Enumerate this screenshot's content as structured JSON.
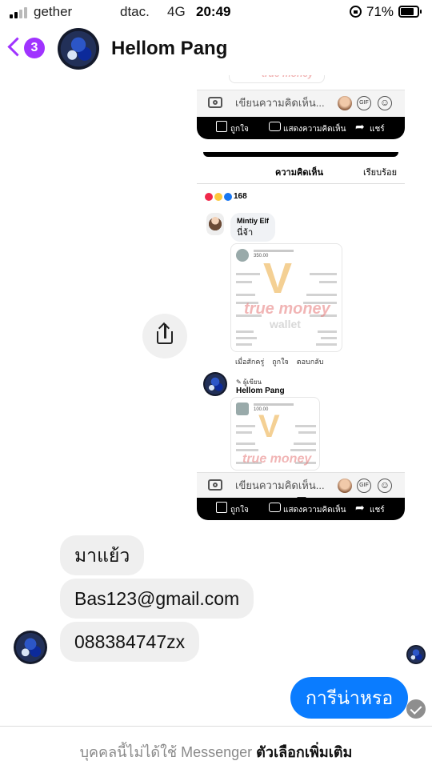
{
  "status_bar": {
    "carrier_primary": "gether",
    "carrier_secondary": "dtac.",
    "network": "4G",
    "time": "20:49",
    "battery": "71%"
  },
  "header": {
    "back_count": "3",
    "contact_name": "Hellom Pang",
    "accent_color": "#a033ff"
  },
  "shared_image": {
    "comment_placeholder": "เขียนความคิดเห็น...",
    "gif_label": "GIF",
    "actions": {
      "like": "ถูกใจ",
      "comment": "แสดงความคิดเห็น",
      "share": "แชร์"
    },
    "comments_title": "ความคิดเห็น",
    "done_label": "เรียบร้อย",
    "reaction_count": "168",
    "comment1": {
      "name": "Mintiy Elf",
      "text": "นี่จ้า"
    },
    "receipt1": {
      "amount": "350.00",
      "wm_brand": "true money",
      "wm_sub": "wallet"
    },
    "comment1_actions": {
      "time": "เมื่อสักครู่",
      "like": "ถูกใจ",
      "reply": "ตอบกลับ"
    },
    "comment2": {
      "author_tag": "ผู้เขียน",
      "name": "Hellom Pang"
    },
    "receipt2": {
      "amount": "100.00",
      "wm_brand": "true money"
    }
  },
  "messages": {
    "incoming": [
      "มาแย้ว",
      "Bas123@gmail.com",
      "088384747zx"
    ],
    "outgoing": "การีน่าหรอ",
    "outgoing_color": "#0a7cff"
  },
  "footer": {
    "notice": "บุคคลนี้ไม่ได้ใช้ Messenger",
    "more_options": "ตัวเลือกเพิ่มเติม"
  }
}
